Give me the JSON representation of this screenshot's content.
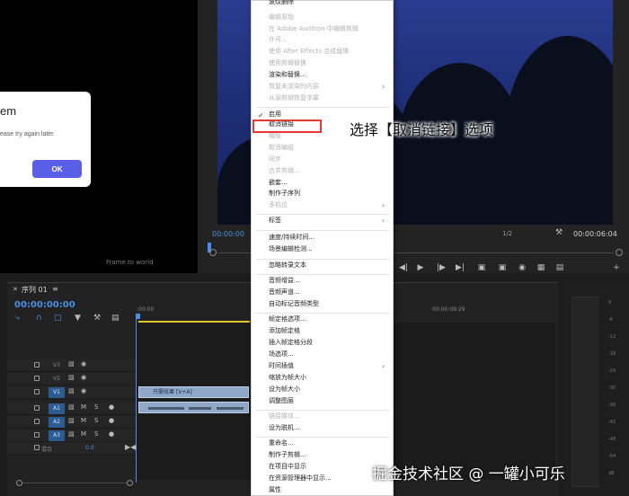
{
  "source_monitor": {
    "dialog_title": "em",
    "dialog_text": "ease try again later.",
    "dialog_ok": "OK",
    "frame_text": "Frame to world"
  },
  "program_monitor": {
    "time_left": "00:00:00",
    "fraction": "1/2",
    "time_right": "00:00:06:04"
  },
  "timeline": {
    "tab_title": "序列 01",
    "timecode": "00:00:00:00",
    "ruler_start": ":00:00",
    "ruler_end": "00:00:09:29",
    "tracks": {
      "v3": "V3",
      "v2": "V2",
      "v1": "V1",
      "a1": "A1",
      "a2": "A2",
      "a3": "A3",
      "m": "M",
      "s": "S"
    },
    "clip_label": "只需效果 [V+A]",
    "mix_label": "混合",
    "mix_value": "0.0"
  },
  "meter": {
    "ticks": [
      "0",
      "-6",
      "-12",
      "-18",
      "-24",
      "-30",
      "-36",
      "-42",
      "-48",
      "-54",
      "dB"
    ]
  },
  "context_menu": {
    "items": [
      {
        "label": "波纹删除",
        "enabled": true
      },
      {
        "label": "编辑原始",
        "enabled": false
      },
      {
        "label": "在 Adobe Audition 中编辑剪辑",
        "enabled": false
      },
      {
        "label": "许可...",
        "enabled": false
      },
      {
        "label": "使用 After Effects 合成替换",
        "enabled": false
      },
      {
        "label": "使用剪辑替换",
        "enabled": false
      },
      {
        "label": "渲染和替换...",
        "enabled": true
      },
      {
        "label": "恢复未渲染的内容",
        "enabled": false
      },
      {
        "label": "从源剪辑恢复字幕",
        "enabled": false
      },
      {
        "label": "启用",
        "enabled": true
      },
      {
        "label": "取消链接",
        "enabled": true
      },
      {
        "label": "编组",
        "enabled": false
      },
      {
        "label": "取消编组",
        "enabled": false
      },
      {
        "label": "同步",
        "enabled": false
      },
      {
        "label": "合并剪辑...",
        "enabled": false
      },
      {
        "label": "嵌套...",
        "enabled": true
      },
      {
        "label": "制作子序列",
        "enabled": true
      },
      {
        "label": "多机位",
        "enabled": false
      },
      {
        "label": "标签",
        "enabled": true
      },
      {
        "label": "速度/持续时间...",
        "enabled": true
      },
      {
        "label": "场景编辑检测...",
        "enabled": true
      },
      {
        "label": "忽略转录文本",
        "enabled": true
      },
      {
        "label": "音频增益...",
        "enabled": true
      },
      {
        "label": "音频声道...",
        "enabled": true
      },
      {
        "label": "自动标记音频类型",
        "enabled": true
      },
      {
        "label": "帧定格选项...",
        "enabled": true
      },
      {
        "label": "添加帧定格",
        "enabled": true
      },
      {
        "label": "插入帧定格分段",
        "enabled": true
      },
      {
        "label": "场选项...",
        "enabled": true
      },
      {
        "label": "时间插值",
        "enabled": true
      },
      {
        "label": "缩放为帧大小",
        "enabled": true
      },
      {
        "label": "设为帧大小",
        "enabled": true
      },
      {
        "label": "调整图层",
        "enabled": true
      },
      {
        "label": "链接媒体...",
        "enabled": false
      },
      {
        "label": "设为脱机...",
        "enabled": true
      },
      {
        "label": "重命名...",
        "enabled": true
      },
      {
        "label": "制作子剪辑...",
        "enabled": true
      },
      {
        "label": "在项目中显示",
        "enabled": true
      },
      {
        "label": "在资源管理器中显示...",
        "enabled": true
      },
      {
        "label": "属性",
        "enabled": true
      }
    ]
  },
  "annotation": "选择【取消链接】选项",
  "watermark": "掘金技术社区 @ 一罐小可乐",
  "colors": {
    "accent": "#4a8fe3",
    "highlight": "#e53935",
    "ok_button": "#5b5ee6"
  }
}
